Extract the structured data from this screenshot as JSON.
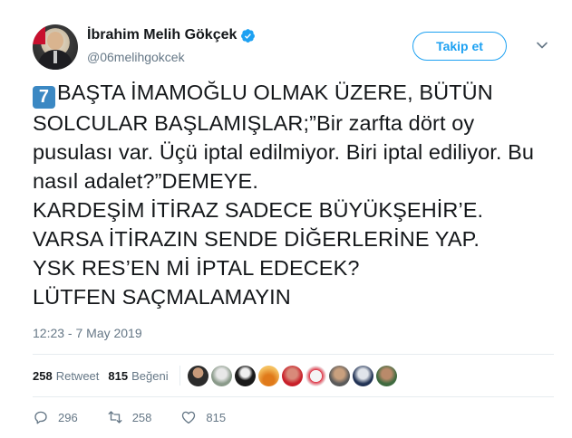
{
  "author": {
    "display_name": "İbrahim Melih Gökçek",
    "handle": "@06melihgokcek",
    "verified": true
  },
  "follow_button_label": "Takip et",
  "tweet": {
    "keycap_number": "7",
    "text": "BAŞTA İMAMOĞLU OLMAK ÜZERE, BÜTÜN SOLCULAR BAŞLAMIŞLAR;”Bir zarfta dört oy pusulası var. Üçü iptal edilmiyor. Biri iptal ediliyor. Bu nasıl adalet?”DEMEYE.\nKARDEŞİM İTİRAZ SADECE BÜYÜKŞEHİR’E. VARSA İTİRAZIN SENDE DİĞERLERİNE YAP.\nYSK RES’EN Mİ İPTAL EDECEK?\nLÜTFEN SAÇMALAMAYIN",
    "timestamp": "12:23 - 7 May 2019"
  },
  "stats": {
    "retweet_count": "258",
    "retweet_label": "Retweet",
    "like_count": "815",
    "like_label": "Beğeni"
  },
  "actions": {
    "reply_count": "296",
    "retweet_count": "258",
    "like_count": "815"
  },
  "colors": {
    "accent": "#1da1f2",
    "secondary_text": "#657786",
    "keycap": "#3b88c3"
  },
  "liker_avatars": [
    "avatar-1",
    "avatar-2",
    "avatar-3",
    "avatar-4",
    "avatar-5",
    "avatar-6",
    "avatar-7",
    "avatar-8",
    "avatar-9"
  ]
}
